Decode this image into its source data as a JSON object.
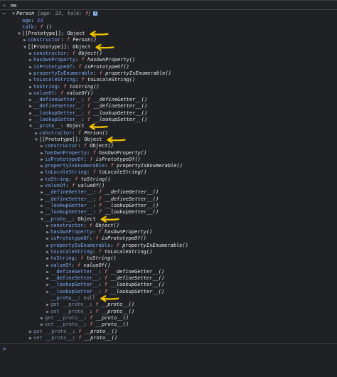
{
  "console": {
    "input_command": "me",
    "result_summary": {
      "class_name": "Person",
      "body": "{age: 23, talk: ",
      "fn_symbol": "f",
      "close": "}"
    },
    "info_badge": "i",
    "prompt_symbol": ">",
    "annotation_color": "#f2c500"
  },
  "tree": [
    {
      "depth": 1,
      "toggle": "none",
      "key": "age",
      "kind": "value",
      "value": "23",
      "vclass": "num"
    },
    {
      "depth": 1,
      "toggle": "none",
      "key": "talk",
      "kind": "fn",
      "fname": "()"
    },
    {
      "depth": 1,
      "toggle": "open",
      "key": "[[Prototype]]",
      "kind": "obj",
      "value": "Object",
      "keyclass": "proto-key",
      "arrow": true
    },
    {
      "depth": 2,
      "toggle": "closed",
      "key": "constructor",
      "kind": "fn",
      "fname": "Person()"
    },
    {
      "depth": 2,
      "toggle": "open",
      "key": "[[Prototype]]",
      "kind": "obj",
      "value": "Object",
      "keyclass": "proto-key",
      "arrow": true
    },
    {
      "depth": 3,
      "toggle": "closed",
      "key": "constructor",
      "kind": "fn",
      "fname": "Object()"
    },
    {
      "depth": 3,
      "toggle": "closed",
      "key": "hasOwnProperty",
      "kind": "fn",
      "fname": "hasOwnProperty()"
    },
    {
      "depth": 3,
      "toggle": "closed",
      "key": "isPrototypeOf",
      "kind": "fn",
      "fname": "isPrototypeOf()"
    },
    {
      "depth": 3,
      "toggle": "closed",
      "key": "propertyIsEnumerable",
      "kind": "fn",
      "fname": "propertyIsEnumerable()"
    },
    {
      "depth": 3,
      "toggle": "closed",
      "key": "toLocaleString",
      "kind": "fn",
      "fname": "toLocaleString()"
    },
    {
      "depth": 3,
      "toggle": "closed",
      "key": "toString",
      "kind": "fn",
      "fname": "toString()"
    },
    {
      "depth": 3,
      "toggle": "closed",
      "key": "valueOf",
      "kind": "fn",
      "fname": "valueOf()"
    },
    {
      "depth": 3,
      "toggle": "closed",
      "key": "__defineGetter__",
      "kind": "fn",
      "fname": "__defineGetter__()"
    },
    {
      "depth": 3,
      "toggle": "closed",
      "key": "__defineSetter__",
      "kind": "fn",
      "fname": "__defineSetter__()"
    },
    {
      "depth": 3,
      "toggle": "closed",
      "key": "__lookupGetter__",
      "kind": "fn",
      "fname": "__lookupGetter__()"
    },
    {
      "depth": 3,
      "toggle": "closed",
      "key": "__lookupSetter__",
      "kind": "fn",
      "fname": "__lookupSetter__()"
    },
    {
      "depth": 3,
      "toggle": "open",
      "key": "__proto__",
      "kind": "obj",
      "value": "Object",
      "arrow": true
    },
    {
      "depth": 4,
      "toggle": "closed",
      "key": "constructor",
      "kind": "fn",
      "fname": "Person()"
    },
    {
      "depth": 4,
      "toggle": "open",
      "key": "[[Prototype]]",
      "kind": "obj",
      "value": "Object",
      "keyclass": "proto-key",
      "arrow": true
    },
    {
      "depth": 5,
      "toggle": "closed",
      "key": "constructor",
      "kind": "fn",
      "fname": "Object()"
    },
    {
      "depth": 5,
      "toggle": "closed",
      "key": "hasOwnProperty",
      "kind": "fn",
      "fname": "hasOwnProperty()"
    },
    {
      "depth": 5,
      "toggle": "closed",
      "key": "isPrototypeOf",
      "kind": "fn",
      "fname": "isPrototypeOf()"
    },
    {
      "depth": 5,
      "toggle": "closed",
      "key": "propertyIsEnumerable",
      "kind": "fn",
      "fname": "propertyIsEnumerable()"
    },
    {
      "depth": 5,
      "toggle": "closed",
      "key": "toLocaleString",
      "kind": "fn",
      "fname": "toLocaleString()"
    },
    {
      "depth": 5,
      "toggle": "closed",
      "key": "toString",
      "kind": "fn",
      "fname": "toString()"
    },
    {
      "depth": 5,
      "toggle": "closed",
      "key": "valueOf",
      "kind": "fn",
      "fname": "valueOf()"
    },
    {
      "depth": 5,
      "toggle": "closed",
      "key": "__defineGetter__",
      "kind": "fn",
      "fname": "__defineGetter__()"
    },
    {
      "depth": 5,
      "toggle": "closed",
      "key": "__defineSetter__",
      "kind": "fn",
      "fname": "__defineSetter__()"
    },
    {
      "depth": 5,
      "toggle": "closed",
      "key": "__lookupGetter__",
      "kind": "fn",
      "fname": "__lookupGetter__()"
    },
    {
      "depth": 5,
      "toggle": "closed",
      "key": "__lookupSetter__",
      "kind": "fn",
      "fname": "__lookupSetter__()"
    },
    {
      "depth": 5,
      "toggle": "open",
      "key": "__proto__",
      "kind": "obj",
      "value": "Object",
      "arrow": true
    },
    {
      "depth": 6,
      "toggle": "closed",
      "key": "constructor",
      "kind": "fn",
      "fname": "Object()"
    },
    {
      "depth": 6,
      "toggle": "closed",
      "key": "hasOwnProperty",
      "kind": "fn",
      "fname": "hasOwnProperty()"
    },
    {
      "depth": 6,
      "toggle": "closed",
      "key": "isPrototypeOf",
      "kind": "fn",
      "fname": "isPrototypeOf()"
    },
    {
      "depth": 6,
      "toggle": "closed",
      "key": "propertyIsEnumerable",
      "kind": "fn",
      "fname": "propertyIsEnumerable()"
    },
    {
      "depth": 6,
      "toggle": "closed",
      "key": "toLocaleString",
      "kind": "fn",
      "fname": "toLocaleString()"
    },
    {
      "depth": 6,
      "toggle": "closed",
      "key": "toString",
      "kind": "fn",
      "fname": "toString()"
    },
    {
      "depth": 6,
      "toggle": "closed",
      "key": "valueOf",
      "kind": "fn",
      "fname": "valueOf()"
    },
    {
      "depth": 6,
      "toggle": "closed",
      "key": "__defineGetter__",
      "kind": "fn",
      "fname": "__defineGetter__()"
    },
    {
      "depth": 6,
      "toggle": "closed",
      "key": "__defineSetter__",
      "kind": "fn",
      "fname": "__defineSetter__()"
    },
    {
      "depth": 6,
      "toggle": "closed",
      "key": "__lookupGetter__",
      "kind": "fn",
      "fname": "__lookupGetter__()"
    },
    {
      "depth": 6,
      "toggle": "closed",
      "key": "__lookupSetter__",
      "kind": "fn",
      "fname": "__lookupSetter__()"
    },
    {
      "depth": 6,
      "toggle": "none",
      "key": "__proto__",
      "kind": "value",
      "value": "null",
      "vclass": "null",
      "arrow": true
    },
    {
      "depth": 6,
      "toggle": "closed",
      "key": "get __proto__",
      "kind": "fn",
      "fname": "__proto__()",
      "keyclass": "key dim"
    },
    {
      "depth": 6,
      "toggle": "closed",
      "key": "set __proto__",
      "kind": "fn",
      "fname": "__proto__()",
      "keyclass": "key dim"
    },
    {
      "depth": 5,
      "toggle": "closed",
      "key": "get __proto__",
      "kind": "fn",
      "fname": "__proto__()",
      "keyclass": "key dim"
    },
    {
      "depth": 5,
      "toggle": "closed",
      "key": "set __proto__",
      "kind": "fn",
      "fname": "__proto__()",
      "keyclass": "key dim"
    },
    {
      "depth": 3,
      "toggle": "closed",
      "key": "get __proto__",
      "kind": "fn",
      "fname": "__proto__()",
      "keyclass": "key dim"
    },
    {
      "depth": 3,
      "toggle": "closed",
      "key": "set __proto__",
      "kind": "fn",
      "fname": "__proto__()",
      "keyclass": "key dim"
    }
  ]
}
